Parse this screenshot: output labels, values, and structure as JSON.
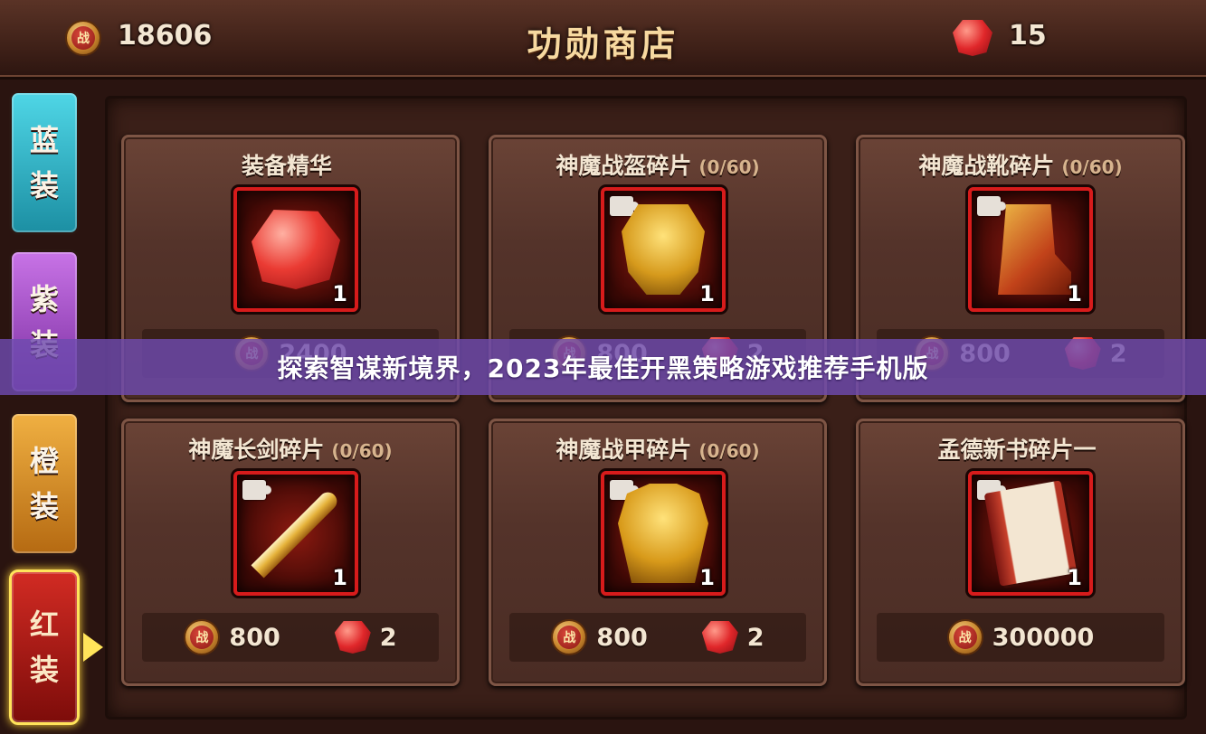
{
  "header": {
    "title": "功勋商店",
    "currency_coin_value": "18606",
    "currency_gem_value": "15",
    "coin_symbol": "战"
  },
  "tabs": [
    {
      "line1": "蓝",
      "line2": "装",
      "color": "#2fb3c6"
    },
    {
      "line1": "紫",
      "line2": "装",
      "color": "#a248c8"
    },
    {
      "line1": "橙",
      "line2": "装",
      "color": "#e0921f"
    },
    {
      "line1": "红",
      "line2": "装",
      "color": "#b5150f",
      "selected": true
    }
  ],
  "cards": [
    {
      "name": "装备精华",
      "progress": "",
      "qty": "1",
      "icon": "essence-gem-icon",
      "coin_price": "2400",
      "gem_price": ""
    },
    {
      "name": "神魔战盔碎片",
      "progress": "(0/60)",
      "qty": "1",
      "icon": "helmet-icon",
      "coin_price": "800",
      "gem_price": "2"
    },
    {
      "name": "神魔战靴碎片",
      "progress": "(0/60)",
      "qty": "1",
      "icon": "boot-icon",
      "coin_price": "800",
      "gem_price": "2"
    },
    {
      "name": "神魔长剑碎片",
      "progress": "(0/60)",
      "qty": "1",
      "icon": "sword-icon",
      "coin_price": "800",
      "gem_price": "2"
    },
    {
      "name": "神魔战甲碎片",
      "progress": "(0/60)",
      "qty": "1",
      "icon": "armor-icon",
      "coin_price": "800",
      "gem_price": "2"
    },
    {
      "name": "孟德新书碎片一",
      "progress": "",
      "qty": "1",
      "icon": "book-icon",
      "coin_price": "300000",
      "gem_price": ""
    }
  ],
  "banner": {
    "text": "探索智谋新境界，2023年最佳开黑策略游戏推荐手机版"
  }
}
